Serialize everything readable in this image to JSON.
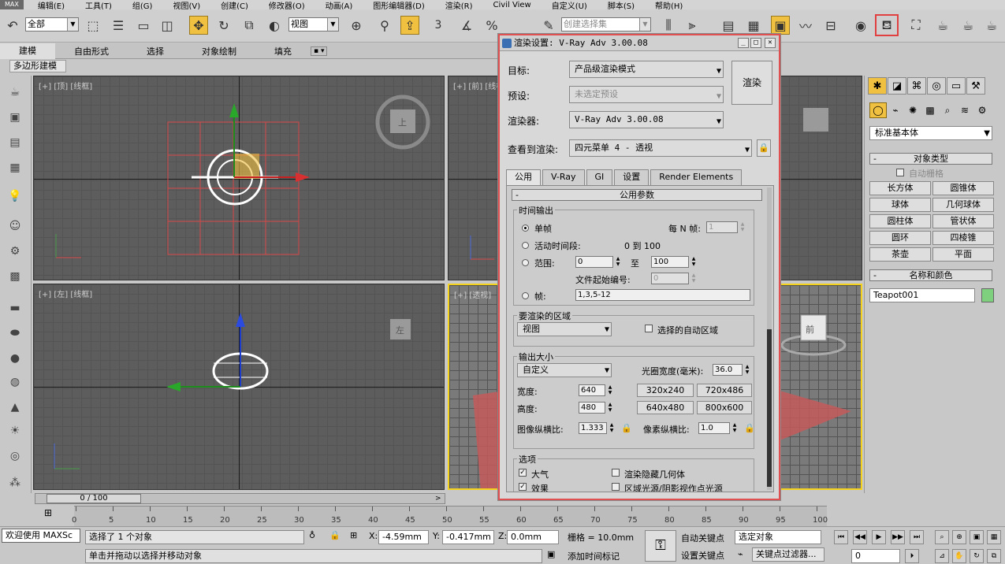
{
  "menu": [
    "MAX",
    "编辑(E)",
    "工具(T)",
    "组(G)",
    "视图(V)",
    "创建(C)",
    "修改器(O)",
    "动画(A)",
    "图形编辑器(D)",
    "渲染(R)",
    "Civil View",
    "自定义(U)",
    "脚本(S)",
    "帮助(H)"
  ],
  "toolbar": {
    "filter_select": "全部",
    "coord_select": "视图",
    "named_selection_placeholder": "创建选择集",
    "snap_label": "3"
  },
  "ribbon": {
    "tabs": [
      "建模",
      "自由形式",
      "选择",
      "对象绘制",
      "填充"
    ],
    "sub": "多边形建模"
  },
  "viewports": {
    "top": "[+] [顶] [线框]",
    "front": "[+] [前] [线框]",
    "left": "[+] [左] [线框]",
    "persp": "[+] [透视]",
    "cube_top": "上",
    "cube_front": "前",
    "cube_left": "左"
  },
  "dialog": {
    "title": "渲染设置: V-Ray Adv 3.00.08",
    "target_label": "目标:",
    "target_value": "产品级渲染模式",
    "preset_label": "预设:",
    "preset_value": "未选定预设",
    "renderer_label": "渲染器:",
    "renderer_value": "V-Ray Adv 3.00.08",
    "view_label": "查看到渲染:",
    "view_value": "四元菜单 4 - 透视",
    "render_button": "渲染",
    "tabs": [
      "公用",
      "V-Ray",
      "GI",
      "设置",
      "Render Elements"
    ],
    "rollout": "公用参数",
    "time_output": {
      "title": "时间输出",
      "single": "单帧",
      "every_n": "每 N 帧:",
      "every_n_value": "1",
      "active_segment": "活动时间段:",
      "active_range": "0 到 100",
      "range": "范围:",
      "range_from": "0",
      "range_to_label": "至",
      "range_to": "100",
      "file_start": "文件起始编号:",
      "file_start_value": "0",
      "frames": "帧:",
      "frames_value": "1,3,5-12"
    },
    "area": {
      "title": "要渲染的区域",
      "value": "视图",
      "auto_region": "选择的自动区域"
    },
    "output_size": {
      "title": "输出大小",
      "preset": "自定义",
      "aperture_label": "光圈宽度(毫米):",
      "aperture": "36.0",
      "width_label": "宽度:",
      "width": "640",
      "height_label": "高度:",
      "height": "480",
      "presets": [
        "320x240",
        "720x486",
        "640x480",
        "800x600"
      ],
      "aspect_label": "图像纵横比:",
      "aspect": "1.333",
      "pixel_aspect_label": "像素纵横比:",
      "pixel_aspect": "1.0"
    },
    "options": {
      "title": "选项",
      "atmos": "大气",
      "hidden": "渲染隐藏几何体",
      "effects": "效果",
      "area_lights": "区域光源/阴影视作点光源"
    }
  },
  "command_panel": {
    "dropdown": "标准基本体",
    "object_type": "对象类型",
    "auto_grid": "自动栅格",
    "buttons": [
      "长方体",
      "圆锥体",
      "球体",
      "几何球体",
      "圆柱体",
      "管状体",
      "圆环",
      "四棱锥",
      "茶壶",
      "平面"
    ],
    "name_color": "名称和颜色",
    "name_value": "Teapot001",
    "name_color_hex": "#7ed07e"
  },
  "timeline": {
    "slider": "0 / 100",
    "ticks": [
      "0",
      "5",
      "10",
      "15",
      "20",
      "25",
      "30",
      "35",
      "40",
      "45",
      "50",
      "55",
      "60",
      "65",
      "70",
      "75",
      "80",
      "85",
      "90",
      "95",
      "100"
    ]
  },
  "status": {
    "welcome": "欢迎使用 MAXSc",
    "selected": "选择了 1 个对象",
    "hint": "单击并拖动以选择并移动对象",
    "x_label": "X:",
    "x": "-4.59mm",
    "y_label": "Y:",
    "y": "-0.417mm",
    "z_label": "Z:",
    "z": "0.0mm",
    "grid": "栅格 = 10.0mm",
    "auto_key": "自动关键点",
    "set_key": "设置关键点",
    "selected_obj": "选定对象",
    "add_tag": "添加时间标记",
    "key_filter": "关键点过滤器...",
    "frame": "0"
  }
}
